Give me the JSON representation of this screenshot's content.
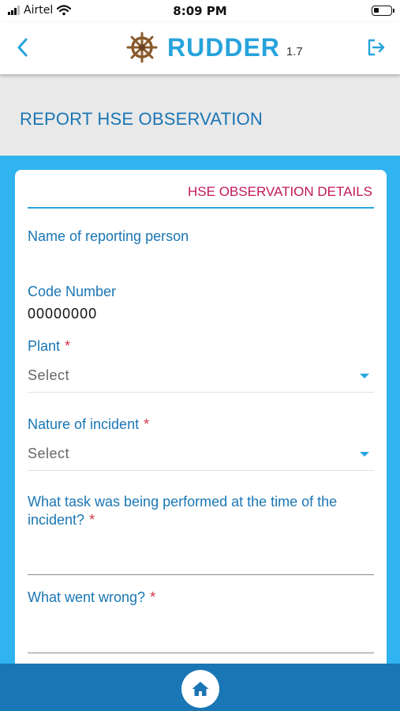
{
  "status_bar": {
    "carrier": "Airtel",
    "time": "8:09 PM"
  },
  "header": {
    "app_name": "RUDDER",
    "version": "1.7"
  },
  "page": {
    "title": "REPORT HSE OBSERVATION"
  },
  "form": {
    "section_title": "HSE OBSERVATION DETAILS",
    "reporting_person_label": "Name of reporting person",
    "code_number_label": "Code Number",
    "code_number_value": "00000000",
    "plant_label": "Plant",
    "plant_value": "Select",
    "nature_label": "Nature of incident",
    "nature_value": "Select",
    "task_label": "What task was being performed at the time of the incident?",
    "wrong_label": "What went wrong?",
    "required_mark": "*"
  },
  "colors": {
    "brand_blue": "#27a3dc",
    "label_blue": "#1a76b4",
    "section_red": "#c0195a",
    "background_blue": "#30b3ee",
    "bottom_bar": "#1a76b4"
  },
  "icons": [
    "wifi-icon",
    "signal-icon",
    "battery-icon",
    "back-chevron-icon",
    "ship-wheel-icon",
    "logout-icon",
    "home-icon",
    "dropdown-caret-icon"
  ]
}
